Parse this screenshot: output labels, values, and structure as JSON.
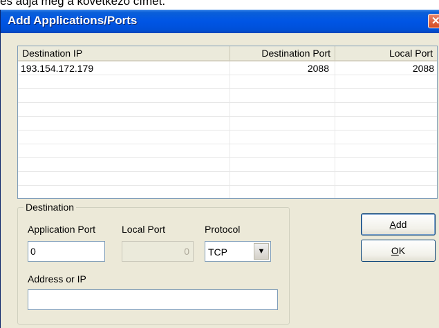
{
  "background_text": "és adja meg a következő címet:",
  "window": {
    "title": "Add Applications/Ports",
    "close_symbol": "✕"
  },
  "list": {
    "columns": [
      "Destination IP",
      "Destination Port",
      "Local Port"
    ],
    "rows": [
      {
        "destination_ip": "193.154.172.179",
        "destination_port": "2088",
        "local_port": "2088"
      }
    ]
  },
  "destination_group": {
    "legend": "Destination",
    "application_port_label": "Application Port",
    "application_port_value": "0",
    "local_port_label": "Local Port",
    "local_port_value": "0",
    "protocol_label": "Protocol",
    "protocol_value": "TCP",
    "address_label": "Address or IP",
    "address_value": ""
  },
  "buttons": {
    "add_accel": "A",
    "add_rest": "dd",
    "ok_accel": "O",
    "ok_rest": "K"
  },
  "colors": {
    "titlebar": "#0055e5",
    "window_face": "#ece9d8",
    "close_button": "#d44a20"
  }
}
